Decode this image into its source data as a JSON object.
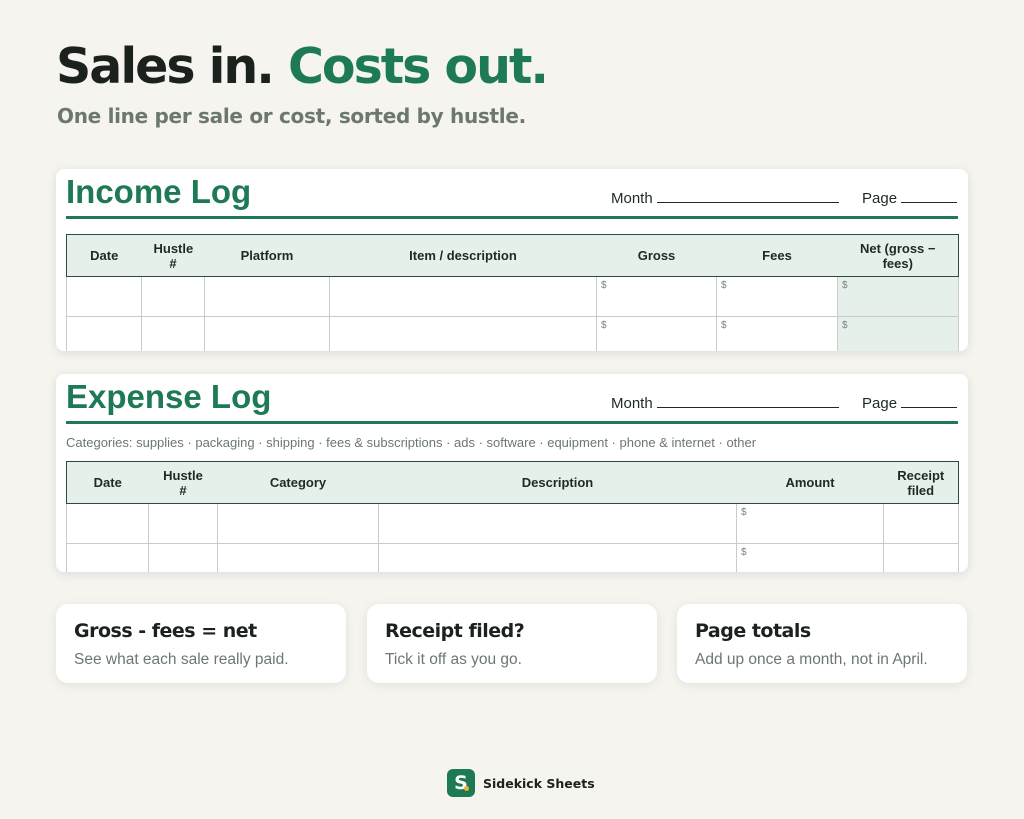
{
  "header": {
    "title_part1": "Sales in.",
    "title_part2": "Costs out.",
    "subtitle": "One line per sale or cost, sorted by hustle."
  },
  "income_log": {
    "title": "Income Log",
    "month_label": "Month",
    "page_label": "Page",
    "columns": [
      "Date",
      "Hustle #",
      "Platform",
      "Item / description",
      "Gross",
      "Fees",
      "Net (gross − fees)"
    ],
    "currency_symbol": "$"
  },
  "expense_log": {
    "title": "Expense Log",
    "month_label": "Month",
    "page_label": "Page",
    "categories_line": "Categories: supplies · packaging · shipping · fees & subscriptions · ads · software · equipment · phone & internet · other",
    "columns": [
      "Date",
      "Hustle #",
      "Category",
      "Description",
      "Amount",
      "Receipt filed"
    ],
    "currency_symbol": "$"
  },
  "tips": [
    {
      "title": "Gross - fees = net",
      "text": "See what each sale really paid."
    },
    {
      "title": "Receipt filed?",
      "text": "Tick it off as you go."
    },
    {
      "title": "Page totals",
      "text": "Add up once a month, not in April."
    }
  ],
  "brand": {
    "logo_letter": "S",
    "name": "Sidekick Sheets"
  },
  "colors": {
    "accent": "#1e7a55",
    "background": "#f5f4ef",
    "header_fill": "#e6f0ea",
    "logo_dot": "#f2b437"
  }
}
